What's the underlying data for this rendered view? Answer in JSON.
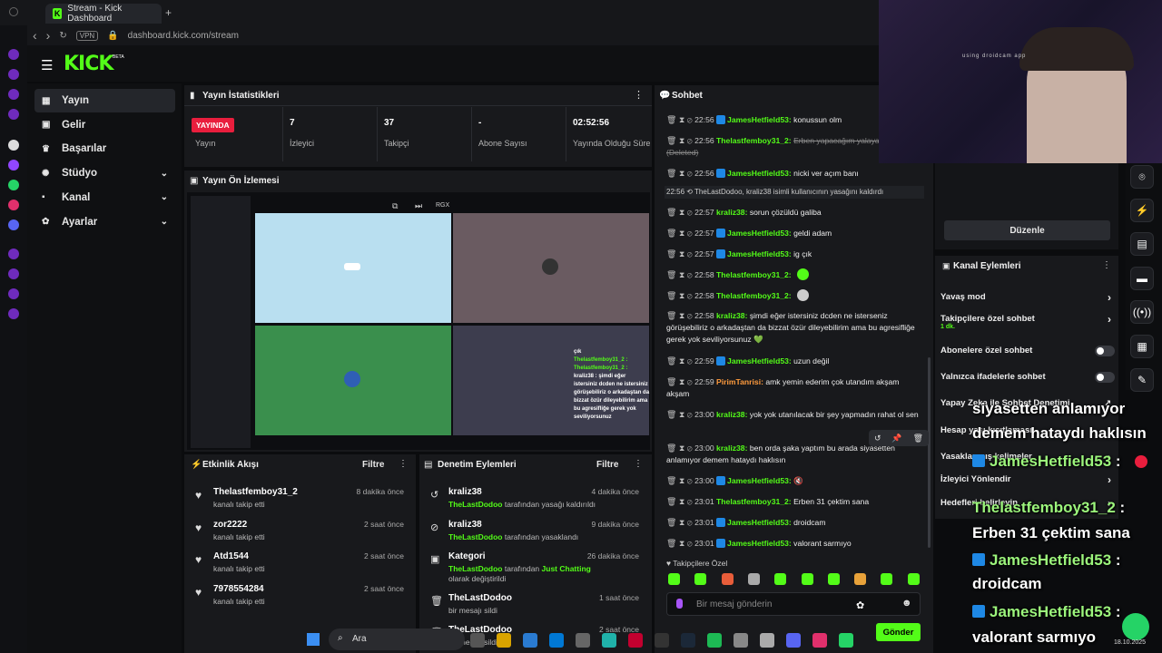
{
  "browser": {
    "tab_title": "Stream - Kick Dashboard",
    "new_tab": "+",
    "vpn": "VPN",
    "url": "dashboard.kick.com/stream",
    "back": "‹",
    "forward": "›",
    "reload": "↻"
  },
  "brand": {
    "logo": "KICK",
    "beta": "BETA",
    "accent": "#53fc18"
  },
  "nav": {
    "items": [
      {
        "label": "Yayın",
        "icon": "broadcast-icon",
        "glyph": "▦"
      },
      {
        "label": "Gelir",
        "icon": "wallet-icon",
        "glyph": "▣"
      },
      {
        "label": "Başarılar",
        "icon": "trophy-icon",
        "glyph": "♛"
      },
      {
        "label": "Stüdyo",
        "icon": "gear-icon",
        "glyph": "✺",
        "chevron": "⌄"
      },
      {
        "label": "Kanal",
        "icon": "user-icon",
        "glyph": "▪",
        "chevron": "⌄"
      },
      {
        "label": "Ayarlar",
        "icon": "settings-icon",
        "glyph": "✿",
        "chevron": "⌄"
      }
    ]
  },
  "stats": {
    "title": "Yayın İstatistikleri",
    "live_badge": "YAYINDA",
    "items": [
      {
        "value": "",
        "label": "Yayın"
      },
      {
        "value": "7",
        "label": "İzleyici"
      },
      {
        "value": "37",
        "label": "Takipçi"
      },
      {
        "value": "-",
        "label": "Abone Sayısı"
      },
      {
        "value": "02:52:56",
        "label": "Yayında Olduğu Süre"
      }
    ]
  },
  "preview": {
    "title": "Yayın Ön İzlemesi",
    "rgx": "RGX",
    "overlay_chat": [
      "çık",
      "Thelastfemboy31_2 :",
      "Thelastfemboy31_2 :",
      "kraliz38 : şimdi eğer istersiniz dcden ne istersiniz görüşebiliriz o arkadaştan da bizzat özür dileyebilirim ama bu agresifliğe gerek yok seviliyorsunuz"
    ]
  },
  "activity": {
    "title": "Etkinlik Akışı",
    "filter": "Filtre",
    "items": [
      {
        "name": "Thelastfemboy31_2",
        "sub": "kanalı takip etti",
        "time": "8 dakika önce"
      },
      {
        "name": "zor2222",
        "sub": "kanalı takip etti",
        "time": "2 saat önce"
      },
      {
        "name": "Atd1544",
        "sub": "kanalı takip etti",
        "time": "2 saat önce"
      },
      {
        "name": "7978554284",
        "sub": "kanalı takip etti",
        "time": "2 saat önce"
      }
    ]
  },
  "moderation": {
    "title": "Denetim Eylemleri",
    "filter": "Filtre",
    "items": [
      {
        "name": "kraliz38",
        "actor": "TheLastDodoo",
        "sub": "tarafından yasağı kaldırıldı",
        "time": "4 dakika önce",
        "glyph": "↺"
      },
      {
        "name": "kraliz38",
        "actor": "TheLastDodoo",
        "sub": "tarafından yasaklandı",
        "time": "9 dakika önce",
        "glyph": "⊘"
      },
      {
        "name": "Kategori",
        "actor": "TheLastDodoo",
        "sub": "tarafından",
        "extra": "Just Chatting",
        "sub2": "olarak değiştirildi",
        "time": "26 dakika önce",
        "glyph": "▣"
      },
      {
        "name": "TheLastDodoo",
        "actor": "",
        "sub": "bir mesajı sildi",
        "time": "1 saat önce",
        "glyph": "🗑"
      },
      {
        "name": "TheLastDodoo",
        "actor": "",
        "sub": "bir mesajı sildi",
        "time": "2 saat önce",
        "glyph": "🗑"
      }
    ]
  },
  "chat": {
    "title": "Sohbet",
    "messages": [
      {
        "time": "22:56",
        "user": "JamesHetfield53:",
        "color": "#53fc18",
        "badge": true,
        "text": "konussun olm"
      },
      {
        "time": "22:56",
        "user": "Thelastfemboy31_2:",
        "color": "#53fc18",
        "badge": false,
        "text": "Erben yapacağım yalayayım (Deleted)"
      },
      {
        "time": "22:56",
        "user": "JamesHetfield53:",
        "color": "#53fc18",
        "badge": true,
        "text": "nicki ver açım banı"
      },
      {
        "time": "22:57",
        "user": "kraliz38:",
        "color": "#53fc18",
        "badge": false,
        "text": "sorun çözüldü galiba"
      },
      {
        "time": "22:57",
        "user": "JamesHetfield53:",
        "color": "#53fc18",
        "badge": true,
        "text": "geldi adam"
      },
      {
        "time": "22:57",
        "user": "JamesHetfield53:",
        "color": "#53fc18",
        "badge": true,
        "text": "ig çık"
      },
      {
        "time": "22:58",
        "user": "Thelastfemboy31_2:",
        "color": "#53fc18",
        "badge": false,
        "text": ""
      },
      {
        "time": "22:58",
        "user": "Thelastfemboy31_2:",
        "color": "#53fc18",
        "badge": false,
        "text": ""
      },
      {
        "time": "22:58",
        "user": "kraliz38:",
        "color": "#53fc18",
        "badge": false,
        "text": "şimdi eğer istersiniz dcden ne isterseniz görüşebiliriz o arkadaştan da bizzat özür dileyebilirim ama bu agresifliğe gerek yok seviliyorsunuz 💚"
      },
      {
        "time": "22:59",
        "user": "JamesHetfield53:",
        "color": "#53fc18",
        "badge": true,
        "text": "uzun değil"
      },
      {
        "time": "22:59",
        "user": "PirimTanrisi:",
        "color": "#ff9b3d",
        "badge": false,
        "text": "amk yemin ederim çok utandım akşam akşam"
      },
      {
        "time": "23:00",
        "user": "kraliz38:",
        "color": "#53fc18",
        "badge": false,
        "text": "yok yok utanılacak bir şey yapmadın rahat ol sen"
      },
      {
        "time": "23:00",
        "user": "kraliz38:",
        "color": "#53fc18",
        "badge": false,
        "text": "ben orda şaka yaptım bu arada siyasetten anlamıyor demem hataydı haklısın"
      },
      {
        "time": "23:00",
        "user": "JamesHetfield53:",
        "color": "#53fc18",
        "badge": true,
        "text": "🔇"
      },
      {
        "time": "23:01",
        "user": "Thelastfemboy31_2:",
        "color": "#53fc18",
        "badge": false,
        "text": "Erben 31 çektim sana"
      },
      {
        "time": "23:01",
        "user": "JamesHetfield53:",
        "color": "#53fc18",
        "badge": true,
        "text": "droidcam"
      },
      {
        "time": "23:01",
        "user": "JamesHetfield53:",
        "color": "#53fc18",
        "badge": true,
        "text": "valorant sarmıyo"
      }
    ],
    "system": {
      "time": "22:56",
      "text": "TheLastDodoo, kraliz38 isimli kullanıcının yasağını kaldırdı"
    },
    "followers_only": "Takipçilere Özel",
    "input_placeholder": "Bir mesaj gönderin",
    "send": "Gönder"
  },
  "channel_actions": {
    "edit": "Düzenle",
    "title": "Kanal Eylemleri",
    "rows": [
      {
        "label": "Yavaş mod",
        "kind": "chevron"
      },
      {
        "label": "Takipçilere özel sohbet",
        "sub": "1 dk.",
        "kind": "chevron"
      },
      {
        "label": "Abonelere özel sohbet",
        "kind": "toggle"
      },
      {
        "label": "Yalnızca ifadelerle sohbet",
        "kind": "toggle"
      },
      {
        "label": "Yapay Zeka ile Sohbet Denetimi",
        "kind": "link"
      },
      {
        "label": "Hesap yaşı kısıtlaması",
        "kind": "chevron"
      },
      {
        "label": "Yasaklanmış kelimeler",
        "kind": "chevron"
      },
      {
        "label": "İzleyici Yönlendir",
        "kind": "chevron"
      },
      {
        "label": "Hedefleri belirleyin",
        "kind": "chevron"
      }
    ]
  },
  "overlay": {
    "watermark": "using droidcam app",
    "lines": [
      {
        "name": "",
        "text": "siyasetten anlamıyor"
      },
      {
        "name": "",
        "text": "demem hataydı haklısın"
      },
      {
        "name": "JamesHetfield53",
        "text": " :",
        "badge": true
      },
      {
        "name": "Thelastfemboy31_2",
        "text": " :"
      },
      {
        "name": "",
        "text": "Erben 31 çektim sana"
      },
      {
        "name": "JamesHetfield53",
        "text": " :",
        "badge": true
      },
      {
        "name": "",
        "text": "droidcam"
      },
      {
        "name": "JamesHetfield53",
        "text": " :",
        "badge": true
      },
      {
        "name": "",
        "text": "valorant sarmıyo"
      }
    ]
  },
  "taskbar": {
    "search": "Ara",
    "time": "",
    "date": "18.10.2025"
  }
}
